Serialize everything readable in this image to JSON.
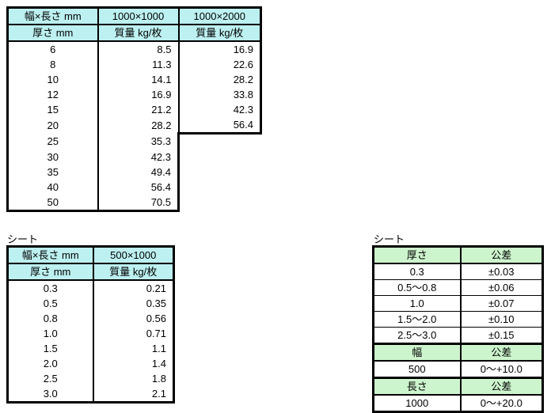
{
  "plate_table": {
    "header_row_1": [
      "幅×長さ mm",
      "1000×1000",
      "1000×2000"
    ],
    "header_row_2": [
      "厚さ mm",
      "質量 kg/枚",
      "質量 kg/枚"
    ],
    "rows": [
      {
        "thickness": "6",
        "mass_1000x1000": "8.5",
        "mass_1000x2000": "16.9"
      },
      {
        "thickness": "8",
        "mass_1000x1000": "11.3",
        "mass_1000x2000": "22.6"
      },
      {
        "thickness": "10",
        "mass_1000x1000": "14.1",
        "mass_1000x2000": "28.2"
      },
      {
        "thickness": "12",
        "mass_1000x1000": "16.9",
        "mass_1000x2000": "33.8"
      },
      {
        "thickness": "15",
        "mass_1000x1000": "21.2",
        "mass_1000x2000": "42.3"
      },
      {
        "thickness": "20",
        "mass_1000x1000": "28.2",
        "mass_1000x2000": "56.4"
      },
      {
        "thickness": "25",
        "mass_1000x1000": "35.3",
        "mass_1000x2000": ""
      },
      {
        "thickness": "30",
        "mass_1000x1000": "42.3",
        "mass_1000x2000": ""
      },
      {
        "thickness": "35",
        "mass_1000x1000": "49.4",
        "mass_1000x2000": ""
      },
      {
        "thickness": "40",
        "mass_1000x1000": "56.4",
        "mass_1000x2000": ""
      },
      {
        "thickness": "50",
        "mass_1000x1000": "70.5",
        "mass_1000x2000": ""
      }
    ]
  },
  "sheet_label_left": "シート",
  "sheet_table": {
    "header_row_1": [
      "幅×長さ mm",
      "500×1000"
    ],
    "header_row_2": [
      "厚さ mm",
      "質量 kg/枚"
    ],
    "rows": [
      {
        "thickness": "0.3",
        "mass": "0.21"
      },
      {
        "thickness": "0.5",
        "mass": "0.35"
      },
      {
        "thickness": "0.8",
        "mass": "0.56"
      },
      {
        "thickness": "1.0",
        "mass": "0.71"
      },
      {
        "thickness": "1.5",
        "mass": "1.1"
      },
      {
        "thickness": "2.0",
        "mass": "1.4"
      },
      {
        "thickness": "2.5",
        "mass": "1.8"
      },
      {
        "thickness": "3.0",
        "mass": "2.1"
      }
    ]
  },
  "sheet_label_right": "シート",
  "tolerance_table": {
    "thickness_header": [
      "厚さ",
      "公差"
    ],
    "thickness_rows": [
      {
        "range": "0.3",
        "tolerance": "±0.03"
      },
      {
        "range": "0.5〜0.8",
        "tolerance": "±0.06"
      },
      {
        "range": "1.0",
        "tolerance": "±0.07"
      },
      {
        "range": "1.5〜2.0",
        "tolerance": "±0.10"
      },
      {
        "range": "2.5〜3.0",
        "tolerance": "±0.15"
      }
    ],
    "width_header": [
      "幅",
      "公差"
    ],
    "width_rows": [
      {
        "value": "500",
        "tolerance": "0〜+10.0"
      }
    ],
    "length_header": [
      "長さ",
      "公差"
    ],
    "length_rows": [
      {
        "value": "1000",
        "tolerance": "0〜+20.0"
      }
    ]
  },
  "colors": {
    "header_cyan": "#bdf0f0",
    "header_green": "#cdf5cd",
    "border": "#000000",
    "background": "#ffffff"
  }
}
